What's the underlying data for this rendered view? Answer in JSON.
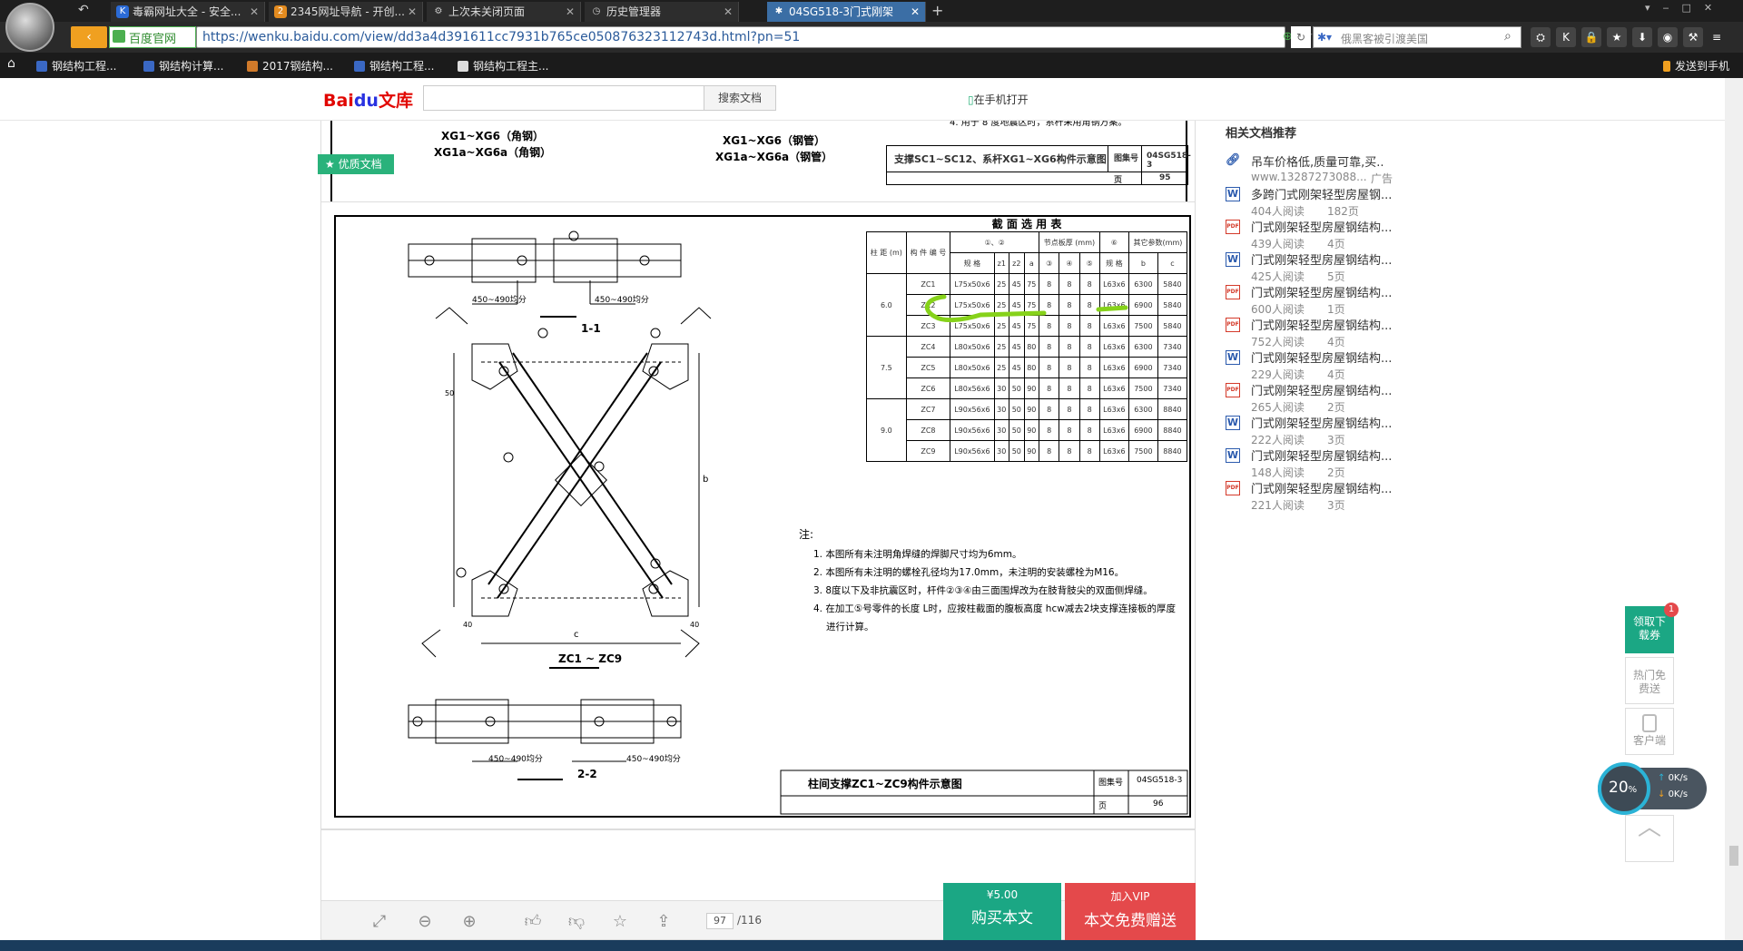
{
  "browser": {
    "tabs": [
      {
        "label": "毒霸网址大全 - 安全...",
        "icon": "K"
      },
      {
        "label": "2345网址导航 - 开创...",
        "icon": "2"
      },
      {
        "label": "上次未关闭页面",
        "icon": "⚙"
      },
      {
        "label": "历史管理器",
        "icon": "◷"
      },
      {
        "label": "04SG518-3门式刚架",
        "icon": "✱"
      }
    ],
    "new_tab": "+",
    "official_badge": "百度官网",
    "url": "https://wenku.baidu.com/view/dd3a4d391611cc7931b765ce050876323112743d.html?pn=51",
    "search_placeholder": "俄黑客被引渡美国",
    "bookmarks": [
      "钢结构工程...",
      "钢结构计算...",
      "2017钢结构...",
      "钢结构工程...",
      "钢结构工程主..."
    ],
    "send_to_phone": "发送到手机"
  },
  "wenku": {
    "logo": "Bai文库",
    "search_button": "搜索文档",
    "mobile_open": "在手机打开",
    "quality_badge": "优质文档"
  },
  "prev_page": {
    "label_angle": "XG1~XG6（角钢）",
    "label_angle_a": "XG1a~XG6a（角钢）",
    "label_pipe": "XG1~XG6（钢管）",
    "label_pipe_a": "XG1a~XG6a（钢管）",
    "note4": "4. 用于 8 度地震区时，系杆采用角钢方案。",
    "title": "支撑SC1~SC12、系杆XG1~XG6构件示意图",
    "atlas_label": "图集号",
    "atlas": "04SG518-3",
    "page_label": "页",
    "page": "95"
  },
  "drawing": {
    "table_title": "截 面 选 用 表",
    "headers": {
      "col_spacing": "柱 距 (m)",
      "member": "构 件 编 号",
      "spec12": "①、②",
      "node": "节点板厚 (mm)",
      "spec6": "⑥",
      "other": "其它参数(mm)",
      "spec": "规 格",
      "z1": "z1",
      "z2": "z2",
      "a": "a",
      "c3": "③",
      "c4": "④",
      "c5": "⑤",
      "spec_b": "规 格",
      "b": "b",
      "c": "c"
    },
    "rows": [
      [
        "ZC1",
        "L75x50x6",
        "25",
        "45",
        "75",
        "8",
        "8",
        "8",
        "L63x6",
        "6300",
        "5840"
      ],
      [
        "ZC2",
        "L75x50x6",
        "25",
        "45",
        "75",
        "8",
        "8",
        "8",
        "L63x6",
        "6900",
        "5840"
      ],
      [
        "ZC3",
        "L75x50x6",
        "25",
        "45",
        "75",
        "8",
        "8",
        "8",
        "L63x6",
        "7500",
        "5840"
      ],
      [
        "ZC4",
        "L80x50x6",
        "25",
        "45",
        "80",
        "8",
        "8",
        "8",
        "L63x6",
        "6300",
        "7340"
      ],
      [
        "ZC5",
        "L80x50x6",
        "25",
        "45",
        "80",
        "8",
        "8",
        "8",
        "L63x6",
        "6900",
        "7340"
      ],
      [
        "ZC6",
        "L80x56x6",
        "30",
        "50",
        "90",
        "8",
        "8",
        "8",
        "L63x6",
        "7500",
        "7340"
      ],
      [
        "ZC7",
        "L90x56x6",
        "30",
        "50",
        "90",
        "8",
        "8",
        "8",
        "L63x6",
        "6300",
        "8840"
      ],
      [
        "ZC8",
        "L90x56x6",
        "30",
        "50",
        "90",
        "8",
        "8",
        "8",
        "L63x6",
        "6900",
        "8840"
      ],
      [
        "ZC9",
        "L90x56x6",
        "30",
        "50",
        "90",
        "8",
        "8",
        "8",
        "L63x6",
        "7500",
        "8840"
      ]
    ],
    "spacings": [
      "6.0",
      "7.5",
      "9.0"
    ],
    "section_11": "1-1",
    "section_22": "2-2",
    "main_label": "ZC1 ~ ZC9",
    "dim_range": "450~490均分",
    "dim_b": "b",
    "dim_c": "c",
    "dim_40": "40",
    "dim_50": "50",
    "notes_title": "注:",
    "notes": [
      "1. 本图所有未注明角焊缝的焊脚尺寸均为6mm。",
      "2. 本图所有未注明的螺栓孔径均为17.0mm，未注明的安装螺栓为M16。",
      "3. 8度以下及非抗震区时，杆件②③④由三面围焊改为在肢背肢尖的双面侧焊缝。",
      "4. 在加工⑤号零件的长度 L时，应按柱截面的腹板高度 hcw减去2块支撑连接板的厚度",
      "进行计算。"
    ],
    "title": "柱间支撑ZC1~ZC9构件示意图",
    "atlas_label": "图集号",
    "atlas": "04SG518-3",
    "page_label": "页",
    "page": "96"
  },
  "related": {
    "title": "相关文档推荐",
    "ad": {
      "title": "吊车价格低,质量可靠,买..",
      "meta": "www.13287273088...",
      "tag": "广告"
    },
    "items": [
      {
        "type": "W",
        "title": "多跨门式刚架轻型房屋钢...",
        "reads": "404人阅读",
        "pages": "182页"
      },
      {
        "type": "PDF",
        "title": "门式刚架轻型房屋钢结构...",
        "reads": "439人阅读",
        "pages": "4页"
      },
      {
        "type": "W",
        "title": "门式刚架轻型房屋钢结构...",
        "reads": "425人阅读",
        "pages": "5页"
      },
      {
        "type": "PDF",
        "title": "门式刚架轻型房屋钢结构...",
        "reads": "600人阅读",
        "pages": "1页"
      },
      {
        "type": "PDF",
        "title": "门式刚架轻型房屋钢结构...",
        "reads": "752人阅读",
        "pages": "4页"
      },
      {
        "type": "W",
        "title": "门式刚架轻型房屋钢结构...",
        "reads": "229人阅读",
        "pages": "4页"
      },
      {
        "type": "PDF",
        "title": "门式刚架轻型房屋钢结构...",
        "reads": "265人阅读",
        "pages": "2页"
      },
      {
        "type": "W",
        "title": "门式刚架轻型房屋钢结构...",
        "reads": "222人阅读",
        "pages": "3页"
      },
      {
        "type": "W",
        "title": "门式刚架轻型房屋钢结构...",
        "reads": "148人阅读",
        "pages": "2页"
      },
      {
        "type": "PDF",
        "title": "门式刚架轻型房屋钢结构...",
        "reads": "221人阅读",
        "pages": "3页"
      }
    ]
  },
  "floating": {
    "coupon": "领取下载券",
    "coupon_badge": "1",
    "hot": "热门免费送",
    "client": "客户端",
    "speed_pct": "20",
    "speed_unit": "%",
    "up": "0K/s",
    "down": "0K/s"
  },
  "viewer": {
    "page_current": "97",
    "page_total": "/116",
    "buy_price": "¥5.00",
    "buy_label": "购买本文",
    "vip_top": "加入VIP",
    "vip_label": "本文免费赠送"
  },
  "colors": {
    "accent": "#3b6ea5",
    "buy": "#1ba784",
    "vip": "#e4494b",
    "wenku_green": "#2ab27b",
    "highlight": "#86d21a"
  }
}
